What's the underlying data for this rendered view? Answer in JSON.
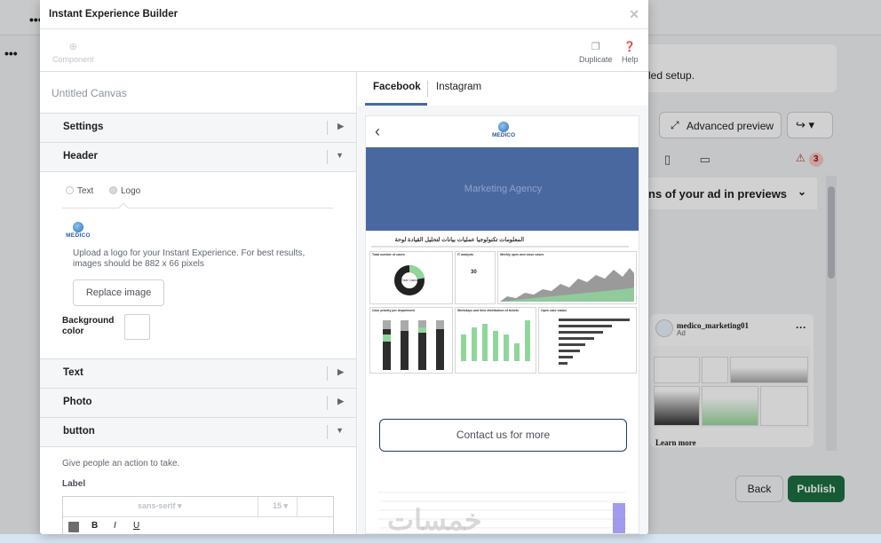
{
  "background": {
    "setup_text": "led setup.",
    "advanced_preview": "Advanced preview",
    "previews_label": "ns of your ad in previews",
    "warning_count": "3",
    "card_page_name": "medico_marketing01",
    "card_sponsored": "Ad",
    "card_learn_more": "Learn more",
    "back_label": "Back",
    "publish_label": "Publish"
  },
  "modal": {
    "title": "Instant Experience Builder",
    "toolbar": {
      "component": "Component",
      "duplicate": "Duplicate",
      "help": "Help"
    },
    "canvas_name": "Untitled Canvas",
    "sections": {
      "settings": "Settings",
      "header": "Header",
      "text": "Text",
      "photo": "Photo",
      "button": "button"
    },
    "header_panel": {
      "option_text": "Text",
      "option_logo": "Logo",
      "logo_text": "MEDICO",
      "upload_instructions": "Upload a logo for your Instant Experience. For best results, images should be 882 x 66 pixels",
      "replace_image": "Replace image",
      "background_color_label": "Background color",
      "background_color": "#ffffff"
    },
    "button_panel": {
      "description": "Give people an action to take.",
      "label_heading": "Label",
      "font": "sans-serif",
      "font_size": "15",
      "bold": "B",
      "italic": "I",
      "underline": "U"
    }
  },
  "preview": {
    "tabs": [
      "Facebook",
      "Instagram"
    ],
    "active_tab": "Facebook",
    "logo_text": "MEDICO",
    "banner_text": "Marketing Agency",
    "dashboard_title": "المعلومات تكنولوجيا عمليات بيانات لتحليل القيادة لوحة",
    "panels": {
      "total_cases": "Total number of cases",
      "it_analysts": "IT analysts",
      "weekly": "Weekly open and close cases",
      "priority": "Case priority per department",
      "weekdays": "Weekdays and time distribution of tickets",
      "open_status": "Open case status"
    },
    "it_analysts_value": "30",
    "donut_center": "Total Cases",
    "cta_label": "Contact us for more",
    "watermark": "خمسات"
  },
  "colors": {
    "brand_blue": "#4267b2",
    "banner": "#4a68a0",
    "publish_green": "#1d6f42",
    "cta_border": "#1c3d67"
  }
}
